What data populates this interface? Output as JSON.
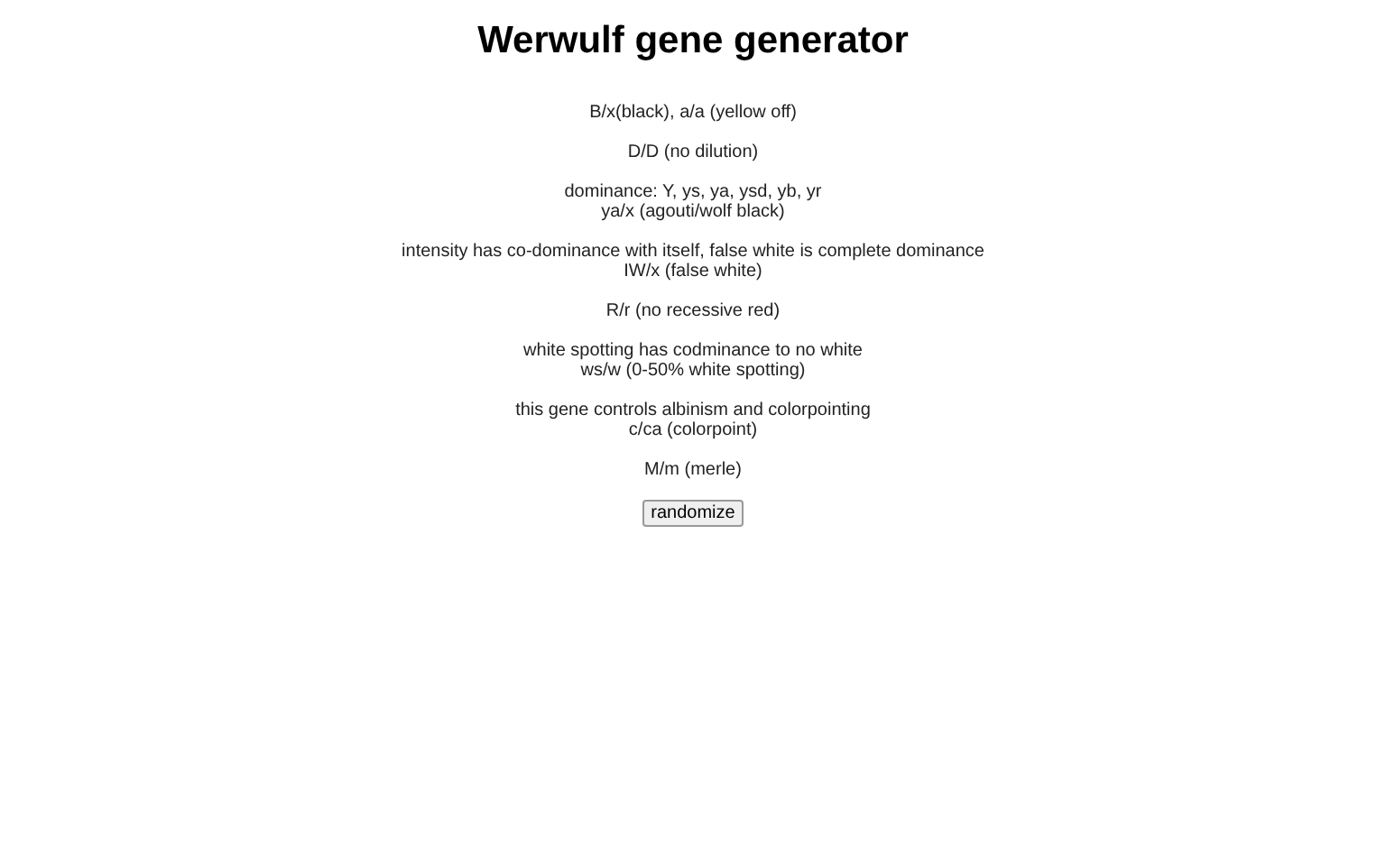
{
  "title": "Werwulf gene generator",
  "genes": [
    {
      "lines": [
        "B/x(black), a/a (yellow off)"
      ]
    },
    {
      "lines": [
        "D/D (no dilution)"
      ]
    },
    {
      "lines": [
        "dominance: Y, ys, ya, ysd, yb, yr",
        "ya/x (agouti/wolf black)"
      ]
    },
    {
      "lines": [
        "intensity has co-dominance with itself, false white is complete dominance",
        "IW/x (false white)"
      ]
    },
    {
      "lines": [
        "R/r (no recessive red)"
      ]
    },
    {
      "lines": [
        "white spotting has codminance to no white",
        "ws/w (0-50% white spotting)"
      ]
    },
    {
      "lines": [
        "this gene controls albinism and colorpointing",
        "c/ca (colorpoint)"
      ]
    },
    {
      "lines": [
        "M/m (merle)"
      ]
    }
  ],
  "button": "randomize"
}
